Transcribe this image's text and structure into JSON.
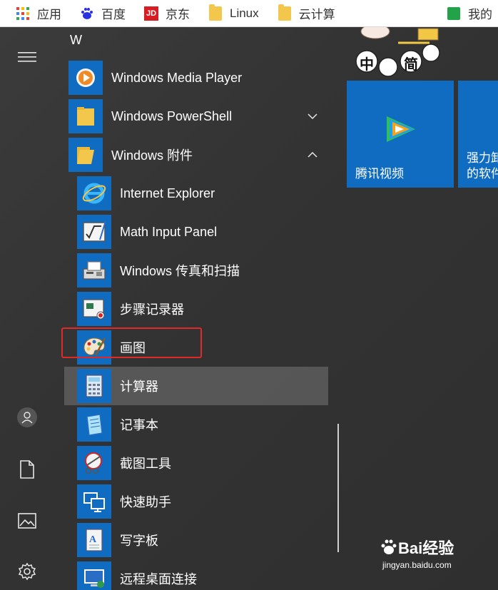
{
  "bookmarks": [
    {
      "label": "应用",
      "icon": "apps-grid-icon"
    },
    {
      "label": "百度",
      "icon": "baidu-paw-icon"
    },
    {
      "label": "京东",
      "icon": "jd-logo-icon",
      "logo_text": "JD"
    },
    {
      "label": "Linux",
      "icon": "folder-icon"
    },
    {
      "label": "云计算",
      "icon": "folder-icon"
    },
    {
      "label": "我的",
      "icon": "green-bookmark-icon"
    }
  ],
  "start_menu": {
    "section_letter": "W",
    "apps": [
      {
        "label": "Windows Media Player",
        "icon": "media-player-icon"
      },
      {
        "label": "Windows PowerShell",
        "icon": "folder-icon",
        "expand": "chevron-down"
      },
      {
        "label": "Windows 附件",
        "icon": "folder-open-icon",
        "expand": "chevron-up"
      },
      {
        "label": "Internet Explorer",
        "icon": "internet-explorer-icon"
      },
      {
        "label": "Math Input Panel",
        "icon": "math-input-icon"
      },
      {
        "label": "Windows 传真和扫描",
        "icon": "fax-scan-icon"
      },
      {
        "label": "步骤记录器",
        "icon": "steps-recorder-icon"
      },
      {
        "label": "画图",
        "icon": "paint-palette-icon"
      },
      {
        "label": "计算器",
        "icon": "calculator-icon"
      },
      {
        "label": "记事本",
        "icon": "notepad-icon"
      },
      {
        "label": "截图工具",
        "icon": "snipping-tool-icon"
      },
      {
        "label": "快速助手",
        "icon": "quick-assist-icon"
      },
      {
        "label": "写字板",
        "icon": "wordpad-icon"
      },
      {
        "label": "远程桌面连接",
        "icon": "remote-desktop-icon"
      }
    ]
  },
  "tiles": [
    {
      "label": "腾讯视频",
      "icon": "tencent-video-icon"
    },
    {
      "label": "强力卸\n的软件",
      "icon": ""
    }
  ],
  "stickers": {
    "chars": [
      "中",
      "简"
    ]
  },
  "watermark": {
    "brand": "Bai经验",
    "url": "jingyan.baidu.com"
  },
  "colors": {
    "tile_blue": "#0f6cc0",
    "highlight_red": "#e02a2a"
  }
}
